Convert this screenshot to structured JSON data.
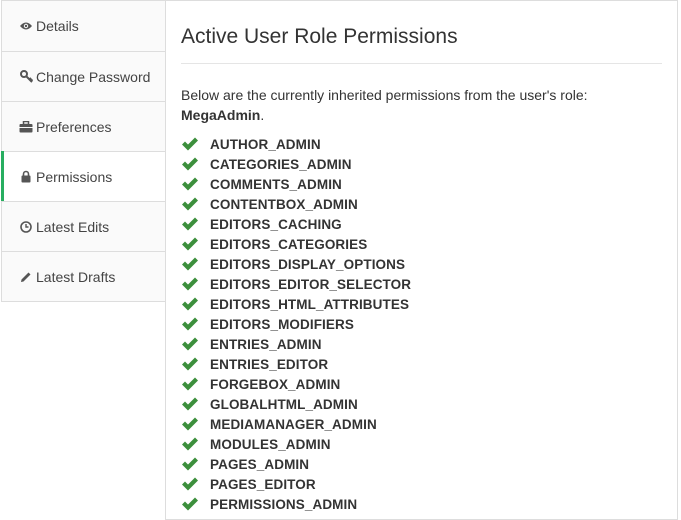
{
  "sidebar": {
    "tabs": [
      {
        "label": "Details",
        "icon": "eye-icon"
      },
      {
        "label": "Change Password",
        "icon": "key-icon"
      },
      {
        "label": "Preferences",
        "icon": "briefcase-icon"
      },
      {
        "label": "Permissions",
        "icon": "lock-icon",
        "active": true
      },
      {
        "label": "Latest Edits",
        "icon": "clock-icon"
      },
      {
        "label": "Latest Drafts",
        "icon": "pencil-icon"
      }
    ]
  },
  "panel": {
    "title": "Active User Role Permissions",
    "intro_text": "Below are the currently inherited permissions from the user's role:",
    "role_name": "MegaAdmin",
    "role_suffix": ".",
    "permissions": [
      "AUTHOR_ADMIN",
      "CATEGORIES_ADMIN",
      "COMMENTS_ADMIN",
      "CONTENTBOX_ADMIN",
      "EDITORS_CACHING",
      "EDITORS_CATEGORIES",
      "EDITORS_DISPLAY_OPTIONS",
      "EDITORS_EDITOR_SELECTOR",
      "EDITORS_HTML_ATTRIBUTES",
      "EDITORS_MODIFIERS",
      "ENTRIES_ADMIN",
      "ENTRIES_EDITOR",
      "FORGEBOX_ADMIN",
      "GLOBALHTML_ADMIN",
      "MEDIAMANAGER_ADMIN",
      "MODULES_ADMIN",
      "PAGES_ADMIN",
      "PAGES_EDITOR",
      "PERMISSIONS_ADMIN"
    ]
  },
  "colors": {
    "check": "#3c8f3c",
    "active_accent": "#27ae60"
  }
}
